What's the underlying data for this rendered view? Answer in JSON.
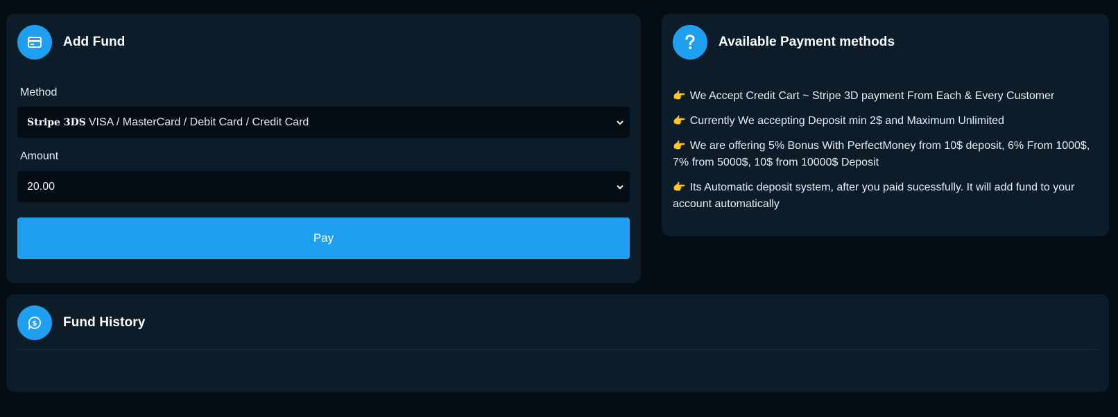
{
  "add_fund": {
    "title": "Add Fund",
    "icon": "credit-card-icon",
    "method_label": "Method",
    "method_tag": "Stripe 3DS",
    "method_value": "VISA / MasterCard / Debit Card / Credit Card",
    "amount_label": "Amount",
    "amount_value": "20.00",
    "pay_label": "Pay"
  },
  "payment_methods": {
    "title": "Available Payment methods",
    "icon": "question-icon",
    "items": [
      "We Accept Credit Cart ~ Stripe 3D payment From Each & Every Customer",
      "Currently We accepting Deposit min 2$ and Maximum Unlimited",
      "We are offering 5% Bonus With PerfectMoney from 10$ deposit, 6% From 1000$, 7% from 5000$, 10$ from 10000$ Deposit",
      "Its Automatic deposit system, after you paid sucessfully. It will add fund to your account automatically"
    ],
    "bullet": "👉"
  },
  "fund_history": {
    "title": "Fund History",
    "icon": "dollar-chat-icon"
  },
  "colors": {
    "accent": "#1f9ff0",
    "background": "#040d14",
    "card": "#0c1c29"
  }
}
